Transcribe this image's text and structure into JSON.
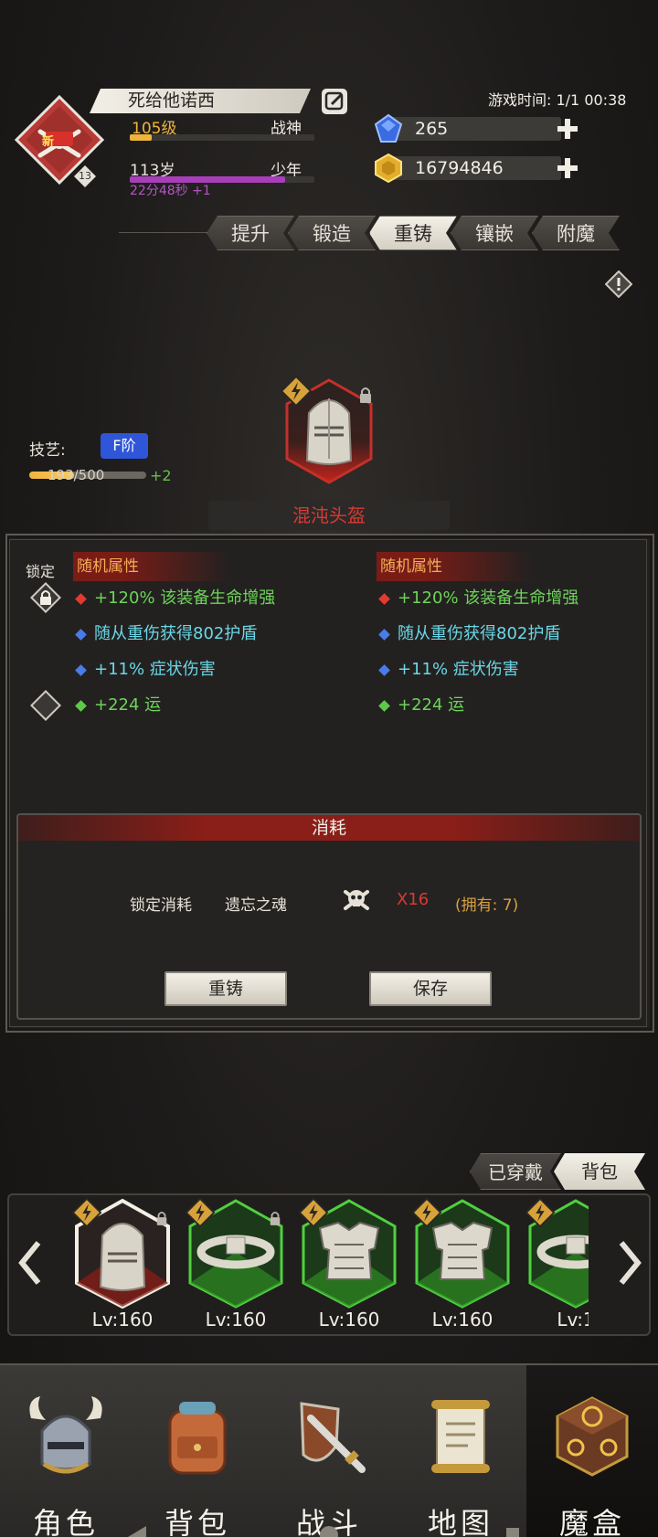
{
  "player": {
    "name": "死给他诺西",
    "badge_text": "新",
    "sub_level": "13",
    "level": "105级",
    "level_progress": 0.12,
    "rank": "战神",
    "age": "113岁",
    "age_progress": 0.84,
    "stage": "少年",
    "timer": "22分48秒 +1"
  },
  "game_time": "游戏时间: 1/1 00:38",
  "currency": {
    "gems": "265",
    "gold": "16794846"
  },
  "tabs": [
    "提升",
    "锻造",
    "重铸",
    "镶嵌",
    "附魔"
  ],
  "active_tab": 2,
  "skill": {
    "label": "技艺:",
    "grade": "F阶",
    "progress_text": "193/500",
    "progress": 0.386,
    "bonus": "+2"
  },
  "item": {
    "name": "混沌头盔"
  },
  "attributes": {
    "lock_label": "锁定",
    "left_header": "随机属性",
    "right_header": "随机属性",
    "left": [
      {
        "text": "+120% 该装备生命增强",
        "color": "green",
        "gem": "#e23a30"
      },
      {
        "text": "随从重伤获得802护盾",
        "color": "cyan",
        "gem": "#4a7be8"
      },
      {
        "text": "+11% 症状伤害",
        "color": "cyan",
        "gem": "#4a7be8"
      },
      {
        "text": "+224 运",
        "color": "green",
        "gem": "#5ec84a"
      }
    ],
    "right": [
      {
        "text": "+120% 该装备生命增强",
        "color": "green",
        "gem": "#e23a30"
      },
      {
        "text": "随从重伤获得802护盾",
        "color": "cyan",
        "gem": "#4a7be8"
      },
      {
        "text": "+11% 症状伤害",
        "color": "cyan",
        "gem": "#4a7be8"
      },
      {
        "text": "+224 运",
        "color": "green",
        "gem": "#5ec84a"
      }
    ]
  },
  "cost": {
    "title": "消耗",
    "label": "锁定消耗",
    "item": "遗忘之魂",
    "qty": "X16",
    "owned": "(拥有: 7)"
  },
  "buttons": {
    "recast": "重铸",
    "save": "保存"
  },
  "bag_tabs": [
    "已穿戴",
    "背包"
  ],
  "equipment": [
    {
      "level": "Lv:160",
      "kind": "helmet",
      "frame": "selected"
    },
    {
      "level": "Lv:160",
      "kind": "belt",
      "frame": "green"
    },
    {
      "level": "Lv:160",
      "kind": "armor",
      "frame": "green"
    },
    {
      "level": "Lv:160",
      "kind": "armor",
      "frame": "green"
    },
    {
      "level": "Lv:1",
      "kind": "belt",
      "frame": "green"
    }
  ],
  "nav": [
    "角色",
    "背包",
    "战斗",
    "地图",
    "魔盒"
  ],
  "active_nav": 4,
  "icons": {
    "edit": "edit-icon",
    "gem": "blue-gem-icon",
    "gold": "gold-coin-icon",
    "info": "warning-icon",
    "skull": "skull-icon"
  }
}
